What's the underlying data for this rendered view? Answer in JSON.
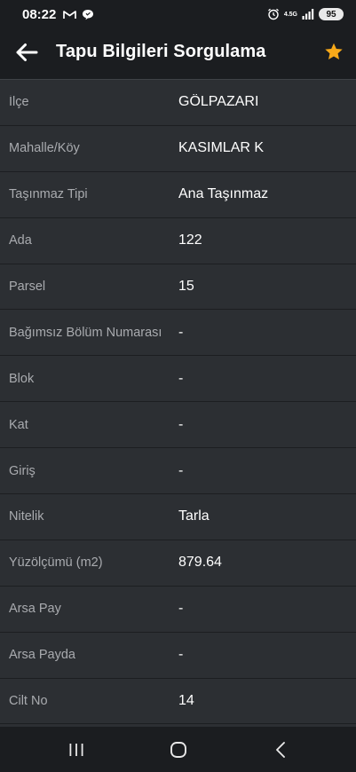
{
  "status_bar": {
    "time": "08:22",
    "network": "4.5G",
    "battery": "95",
    "icons": [
      "gmail-icon",
      "chat-bubble-icon",
      "alarm-icon",
      "signal-icon",
      "battery-icon"
    ]
  },
  "toolbar": {
    "title": "Tapu Bilgileri Sorgulama",
    "back_icon": "arrow-left-icon",
    "favorite_icon": "star-icon",
    "favorite_color": "#f7a919"
  },
  "rows": [
    {
      "label": "İlçe",
      "value": "GÖLPAZARI"
    },
    {
      "label": "Mahalle/Köy",
      "value": "KASIMLAR K"
    },
    {
      "label": "Taşınmaz Tipi",
      "value": "Ana Taşınmaz"
    },
    {
      "label": "Ada",
      "value": "122"
    },
    {
      "label": "Parsel",
      "value": "15"
    },
    {
      "label": "Bağımsız Bölüm Numarası",
      "value": "-"
    },
    {
      "label": "Blok",
      "value": "-"
    },
    {
      "label": "Kat",
      "value": "-"
    },
    {
      "label": "Giriş",
      "value": "-"
    },
    {
      "label": "Nitelik",
      "value": "Tarla"
    },
    {
      "label": "Yüzölçümü (m2)",
      "value": "879.64"
    },
    {
      "label": "Arsa Pay",
      "value": "-"
    },
    {
      "label": "Arsa Payda",
      "value": "-"
    },
    {
      "label": "Cilt No",
      "value": "14"
    }
  ],
  "nav_bar": {
    "icons": [
      "recent-apps-icon",
      "home-icon",
      "back-icon"
    ]
  }
}
